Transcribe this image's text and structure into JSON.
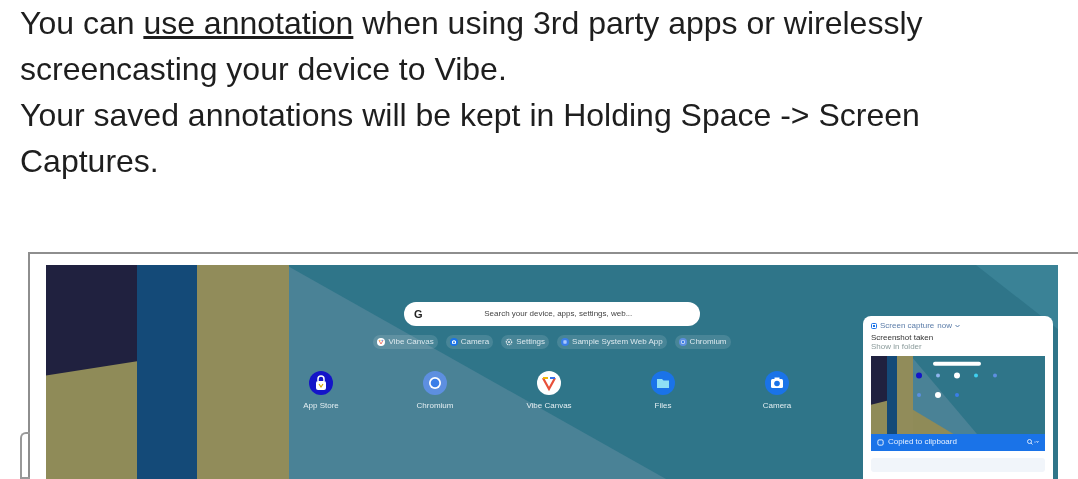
{
  "article": {
    "paragraphs": [
      {
        "parts": [
          {
            "text": "You can ",
            "kind": "text"
          },
          {
            "text": "use annotation",
            "kind": "link"
          },
          {
            "text": " when using 3rd party apps or wirelessly screencasting your device to Vibe.",
            "kind": "text"
          }
        ]
      },
      {
        "parts": [
          {
            "text": "Your saved annotations will be kept in Holding Space -> Screen Captures.",
            "kind": "text"
          }
        ]
      }
    ]
  },
  "screenshot": {
    "search": {
      "logo": "G",
      "placeholder": "Search your device, apps, settings, web..."
    },
    "suggestions": [
      {
        "label": "Vibe Canvas"
      },
      {
        "label": "Camera"
      },
      {
        "label": "Settings"
      },
      {
        "label": "Sample System Web App"
      },
      {
        "label": "Chromium"
      }
    ],
    "apps": [
      {
        "label": "App Store"
      },
      {
        "label": "Chromium"
      },
      {
        "label": "Vibe Canvas"
      },
      {
        "label": "Files"
      },
      {
        "label": "Camera"
      }
    ],
    "notification": {
      "source": "Screen capture",
      "time": "now",
      "title": "Screenshot taken",
      "action": "Show in folder",
      "banner": "Copied to clipboard"
    }
  }
}
